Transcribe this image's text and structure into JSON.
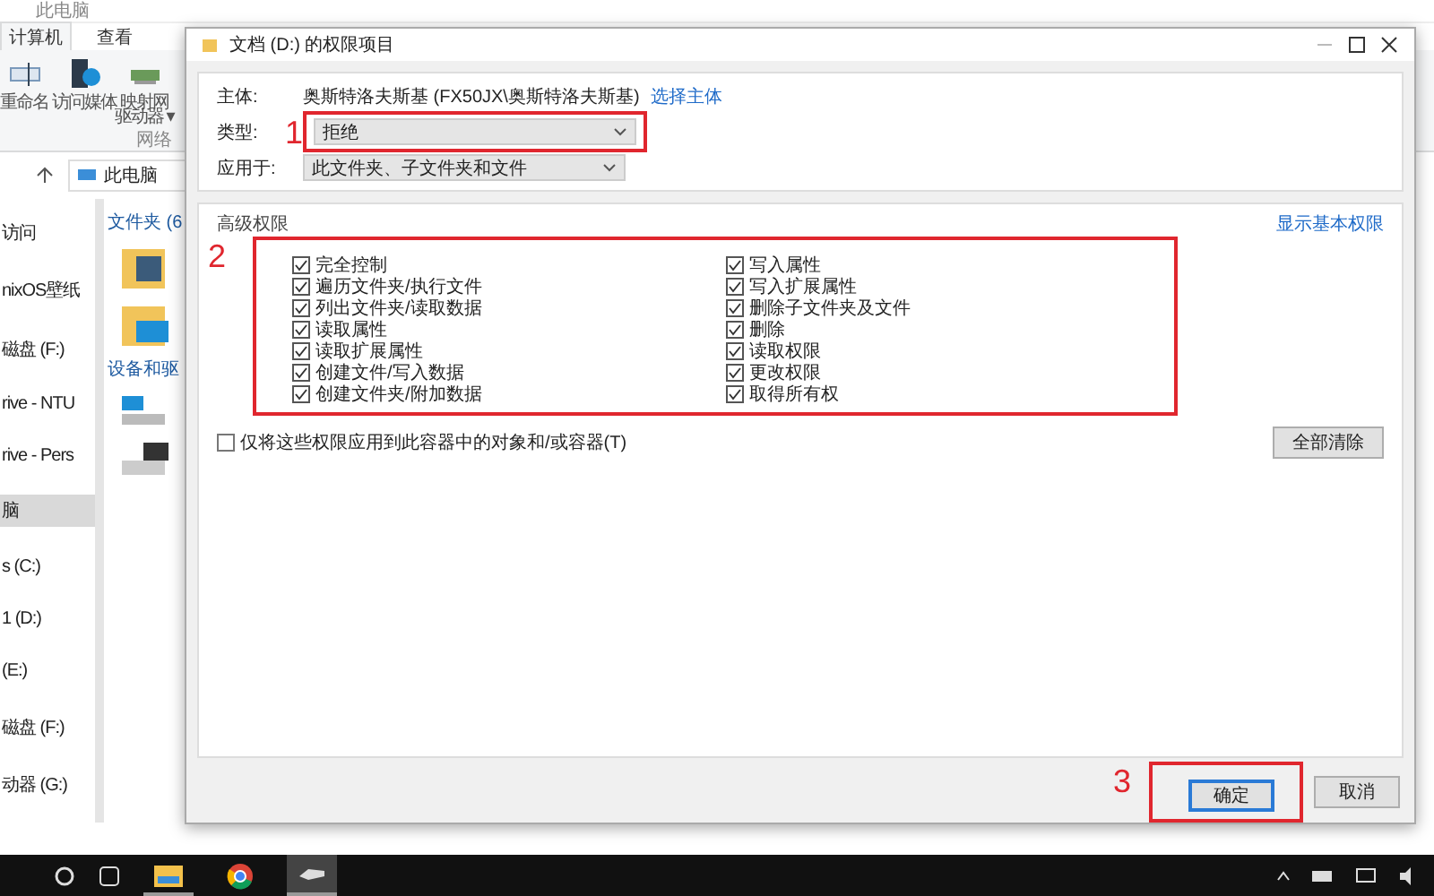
{
  "explorer": {
    "title": "此电脑",
    "tabs": [
      {
        "label": "计算机",
        "selected": true
      },
      {
        "label": "查看",
        "selected": false
      }
    ],
    "ribbon": [
      {
        "label": "重命名",
        "kind": "rename"
      },
      {
        "label": "访问媒体",
        "kind": "media"
      },
      {
        "label": "映射网",
        "kind": "network"
      }
    ],
    "ribbon_sub": "驱动器 ▾",
    "ribbon_group": "网络",
    "address": "此电脑",
    "sidebar": [
      {
        "label": "访问",
        "selected": false
      },
      {
        "label": "nixOS壁纸",
        "selected": false
      },
      {
        "label": "磁盘 (F:)",
        "selected": false
      },
      {
        "label": "rive - NTU",
        "selected": false
      },
      {
        "label": "rive - Pers",
        "selected": false
      },
      {
        "label": "脑",
        "selected": true
      },
      {
        "label": "s (C:)",
        "selected": false
      },
      {
        "label": "1 (D:)",
        "selected": false
      },
      {
        "label": "(E:)",
        "selected": false
      },
      {
        "label": "磁盘 (F:)",
        "selected": false
      },
      {
        "label": "动器 (G:)",
        "selected": false
      }
    ],
    "sections": [
      {
        "label": "文件夹 (6",
        "kind": "folders"
      },
      {
        "label": "设备和驱",
        "kind": "drives"
      }
    ]
  },
  "dialog": {
    "title": "文档 (D:) 的权限项目",
    "principal": {
      "label": "主体:",
      "value": "奥斯特洛夫斯基 (FX50JX\\奥斯特洛夫斯基)",
      "link": "选择主体"
    },
    "type": {
      "label": "类型:",
      "value": "拒绝",
      "annotation": "1"
    },
    "applies_to": {
      "label": "应用于:",
      "value": "此文件夹、子文件夹和文件"
    },
    "advanced": {
      "title": "高级权限",
      "link": "显示基本权限",
      "annotation": "2",
      "left": [
        {
          "label": "完全控制",
          "checked": true
        },
        {
          "label": "遍历文件夹/执行文件",
          "checked": true
        },
        {
          "label": "列出文件夹/读取数据",
          "checked": true
        },
        {
          "label": "读取属性",
          "checked": true
        },
        {
          "label": "读取扩展属性",
          "checked": true
        },
        {
          "label": "创建文件/写入数据",
          "checked": true
        },
        {
          "label": "创建文件夹/附加数据",
          "checked": true
        }
      ],
      "right": [
        {
          "label": "写入属性",
          "checked": true
        },
        {
          "label": "写入扩展属性",
          "checked": true
        },
        {
          "label": "删除子文件夹及文件",
          "checked": true
        },
        {
          "label": "删除",
          "checked": true
        },
        {
          "label": "读取权限",
          "checked": true
        },
        {
          "label": "更改权限",
          "checked": true
        },
        {
          "label": "取得所有权",
          "checked": true
        }
      ]
    },
    "only_apply": {
      "label": "仅将这些权限应用到此容器中的对象和/或容器(T)",
      "checked": false
    },
    "clear_all": "全部清除",
    "buttons": [
      {
        "label": "确定",
        "default": true,
        "annotation": "3"
      },
      {
        "label": "取消",
        "default": false
      }
    ]
  },
  "taskbar": {
    "apps": [
      {
        "kind": "files",
        "open": true,
        "active": false
      },
      {
        "kind": "browser",
        "open": false,
        "active": false
      },
      {
        "kind": "drive",
        "open": true,
        "active": true
      }
    ]
  }
}
